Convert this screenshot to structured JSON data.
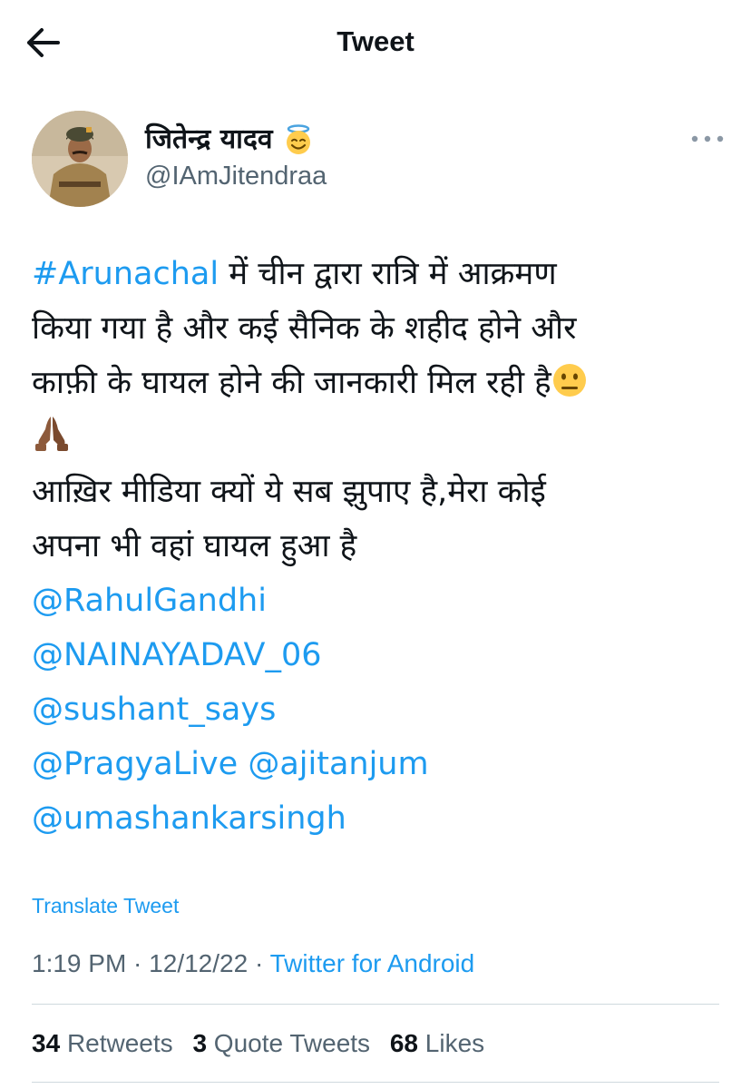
{
  "header": {
    "title": "Tweet",
    "back_icon": "arrow-left-icon"
  },
  "author": {
    "name": "जितेन्द्र यादव",
    "handle": "@IAmJitendraa",
    "name_emoji": "smiling-face-with-halo-icon"
  },
  "more_icon": "more-dots-icon",
  "tweet": {
    "hashtag": "#Arunachal",
    "line1_rest": " में चीन द्वारा रात्रि में आक्रमण",
    "line2": "किया गया है और कई सैनिक के शहीद होने और",
    "line3": "काफ़ी के घायल होने की जानकारी मिल रही है",
    "line3_emoji": "neutral-face-icon",
    "line4_emoji": "folded-hands-icon",
    "line5": "आख़िर मीडिया क्यों ये सब झुपाए है,मेरा कोई",
    "line6": "अपना भी वहां घायल हुआ है",
    "mentions": [
      "@RahulGandhi",
      "@NAINAYADAV_06",
      "@sushant_says",
      "@PragyaLive",
      "@ajitanjum",
      "@umashankarsingh"
    ]
  },
  "translate_label": "Translate Tweet",
  "meta": {
    "time": "1:19 PM",
    "separator": " · ",
    "date": "12/12/22",
    "source": "Twitter for Android"
  },
  "stats": {
    "retweets_count": "34",
    "retweets_label": "Retweets",
    "quotes_count": "3",
    "quotes_label": "Quote Tweets",
    "likes_count": "68",
    "likes_label": "Likes"
  },
  "colors": {
    "link": "#1d9bf0",
    "text": "#0f1419",
    "secondary": "#536471",
    "divider": "#cfd9de"
  }
}
